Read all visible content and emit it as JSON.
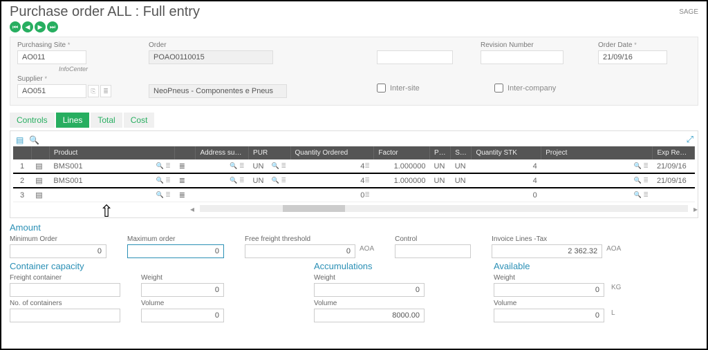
{
  "title": "Purchase order ALL : Full entry",
  "brand": "SAGE",
  "header": {
    "purchasing_site_label": "Purchasing Site",
    "purchasing_site": "AO011",
    "order_label": "Order",
    "order": "POAO0110015",
    "revision_label": "Revision Number",
    "revision": "",
    "order_date_label": "Order Date",
    "order_date": "21/09/16",
    "infocenter": "InfoCenter",
    "supplier_label": "Supplier",
    "supplier": "AO051",
    "supplier_name": "NeoPneus - Componentes e Pneus",
    "intersite_label": "Inter-site",
    "intercompany_label": "Inter-company"
  },
  "tabs": {
    "controls": "Controls",
    "lines": "Lines",
    "total": "Total",
    "cost": "Cost"
  },
  "grid": {
    "cols": {
      "product": "Product",
      "addr": "Address sub-c…",
      "pur": "PUR",
      "qtyo": "Quantity Ordered",
      "factor": "Factor",
      "p": "P…",
      "s": "S…",
      "qtystk": "Quantity STK",
      "project": "Project",
      "exp": "Exp Rec Date"
    },
    "rows": [
      {
        "n": "1",
        "product": "BMS001",
        "pur": "UN",
        "qtyo": "4",
        "factor": "1.000000",
        "p": "UN",
        "s": "UN",
        "qtystk": "4",
        "exp": "21/09/16"
      },
      {
        "n": "2",
        "product": "BMS001",
        "pur": "UN",
        "qtyo": "4",
        "factor": "1.000000",
        "p": "UN",
        "s": "UN",
        "qtystk": "4",
        "exp": "21/09/16"
      },
      {
        "n": "3",
        "product": "",
        "pur": "",
        "qtyo": "0",
        "factor": "",
        "p": "",
        "s": "",
        "qtystk": "0",
        "exp": ""
      }
    ]
  },
  "amount": {
    "title": "Amount",
    "min_label": "Minimum Order",
    "min": "0",
    "max_label": "Maximum order",
    "max": "0",
    "free_label": "Free freight threshold",
    "free": "0",
    "free_unit": "AOA",
    "ctrl_label": "Control",
    "ctrl": "",
    "inv_label": "Invoice Lines -Tax",
    "inv": "2 362.32",
    "inv_unit": "AOA"
  },
  "container": {
    "title": "Container capacity",
    "fc_label": "Freight container",
    "fc": "",
    "w_label": "Weight",
    "w": "0",
    "nc_label": "No. of containers",
    "nc": "",
    "v_label": "Volume",
    "v": "0"
  },
  "accum": {
    "title": "Accumulations",
    "w_label": "Weight",
    "w": "0",
    "v_label": "Volume",
    "v": "8000.00"
  },
  "avail": {
    "title": "Available",
    "w_label": "Weight",
    "w": "0",
    "w_unit": "KG",
    "v_label": "Volume",
    "v": "0",
    "v_unit": "L"
  }
}
